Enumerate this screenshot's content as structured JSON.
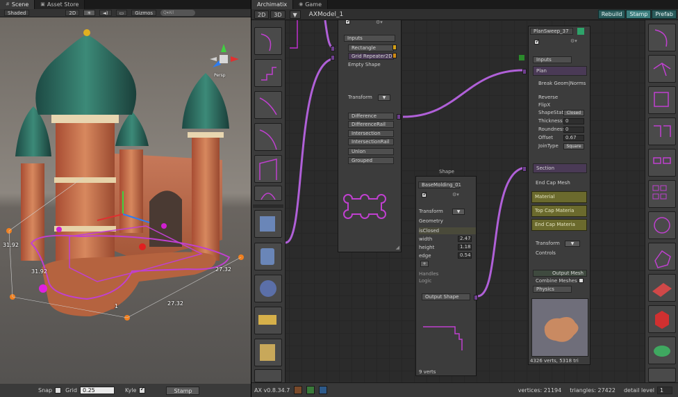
{
  "scene": {
    "tabs": [
      {
        "label": "Scene"
      },
      {
        "label": "Asset Store"
      }
    ],
    "toolbar": {
      "shading": "Shaded",
      "mode_2d": "2D",
      "gizmos": "Gizmos",
      "search_placeholder": "Q▾All"
    },
    "gizmo_label": "Persp",
    "dimensions": {
      "d1": "31.92",
      "d2": "31.92",
      "d3": "27.32",
      "d4": "27.32",
      "d5": "1"
    },
    "bottom": {
      "snap_label": "Snap",
      "grid_label": "Grid",
      "grid_value": "0.25",
      "kyle_label": "Kyle",
      "stamp_label": "Stamp"
    }
  },
  "archi": {
    "tabs": [
      {
        "label": "Archimatix"
      },
      {
        "label": "Game"
      }
    ],
    "toolbar": {
      "btn_2d": "2D",
      "btn_3d": "3D",
      "model_title": "AXModel_1",
      "rebuild": "Rebuild",
      "stamp": "Stamp",
      "prefab": "Prefab"
    },
    "node_grid": {
      "inputs_label": "Inputs",
      "inputs": [
        "Rectangle",
        "Grid Repeater2D",
        "Empty Shape"
      ],
      "transform_label": "Transform",
      "ops": [
        "Difference",
        "DifferenceRail",
        "Intersection",
        "IntersectionRail",
        "Union",
        "Grouped"
      ]
    },
    "node_shape": {
      "window_title": "Shape",
      "name": "BaseMolding_01",
      "transform_label": "Transform",
      "geometry_label": "Geometry",
      "params": [
        {
          "label": "isClosed",
          "value": "✓"
        },
        {
          "label": "width",
          "value": "2.47"
        },
        {
          "label": "height",
          "value": "1.18"
        },
        {
          "label": "edge",
          "value": "0.54"
        }
      ],
      "handles_label": "Handles",
      "logic_label": "Logic",
      "output_label": "Output Shape",
      "verts": "9 verts"
    },
    "node_plansweep": {
      "name": "PlanSweep_37",
      "inputs_label": "Inputs",
      "plan_label": "Plan",
      "break_label": "Break Geom|Norms",
      "reverse_label": "Reverse",
      "flipx_label": "FlipX",
      "shapestate_label": "ShapeState",
      "shapestate_value": "Closed",
      "thickness_label": "Thickness",
      "thickness_value": "0",
      "roundness_label": "Roundness",
      "roundness_value": "0",
      "offset_label": "Offset",
      "offset_value": "0.67",
      "jointype_label": "JoinType",
      "jointype_value": "Square",
      "section_label": "Section",
      "endcap_label": "End Cap Mesh",
      "material_label": "Material",
      "topcap_label": "Top Cap Materia",
      "endcapmat_label": "End Cap Materia",
      "transform_label": "Transform",
      "controls_label": "Controls",
      "output_label": "Output Mesh",
      "combine_label": "Combine Meshes",
      "physics_label": "Physics",
      "stats": "4326 verts, 5318 tri"
    },
    "status": {
      "version": "AX v0.8.34.7",
      "vertices_label": "vertices: 21194",
      "triangles_label": "triangles: 27422",
      "detail_label": "detail level",
      "detail_value": "1"
    }
  },
  "colors": {
    "accent_purple": "#b04bd0",
    "wire": "#c070e0",
    "teal": "#2b5c5c",
    "olive": "#6b6a2d"
  }
}
